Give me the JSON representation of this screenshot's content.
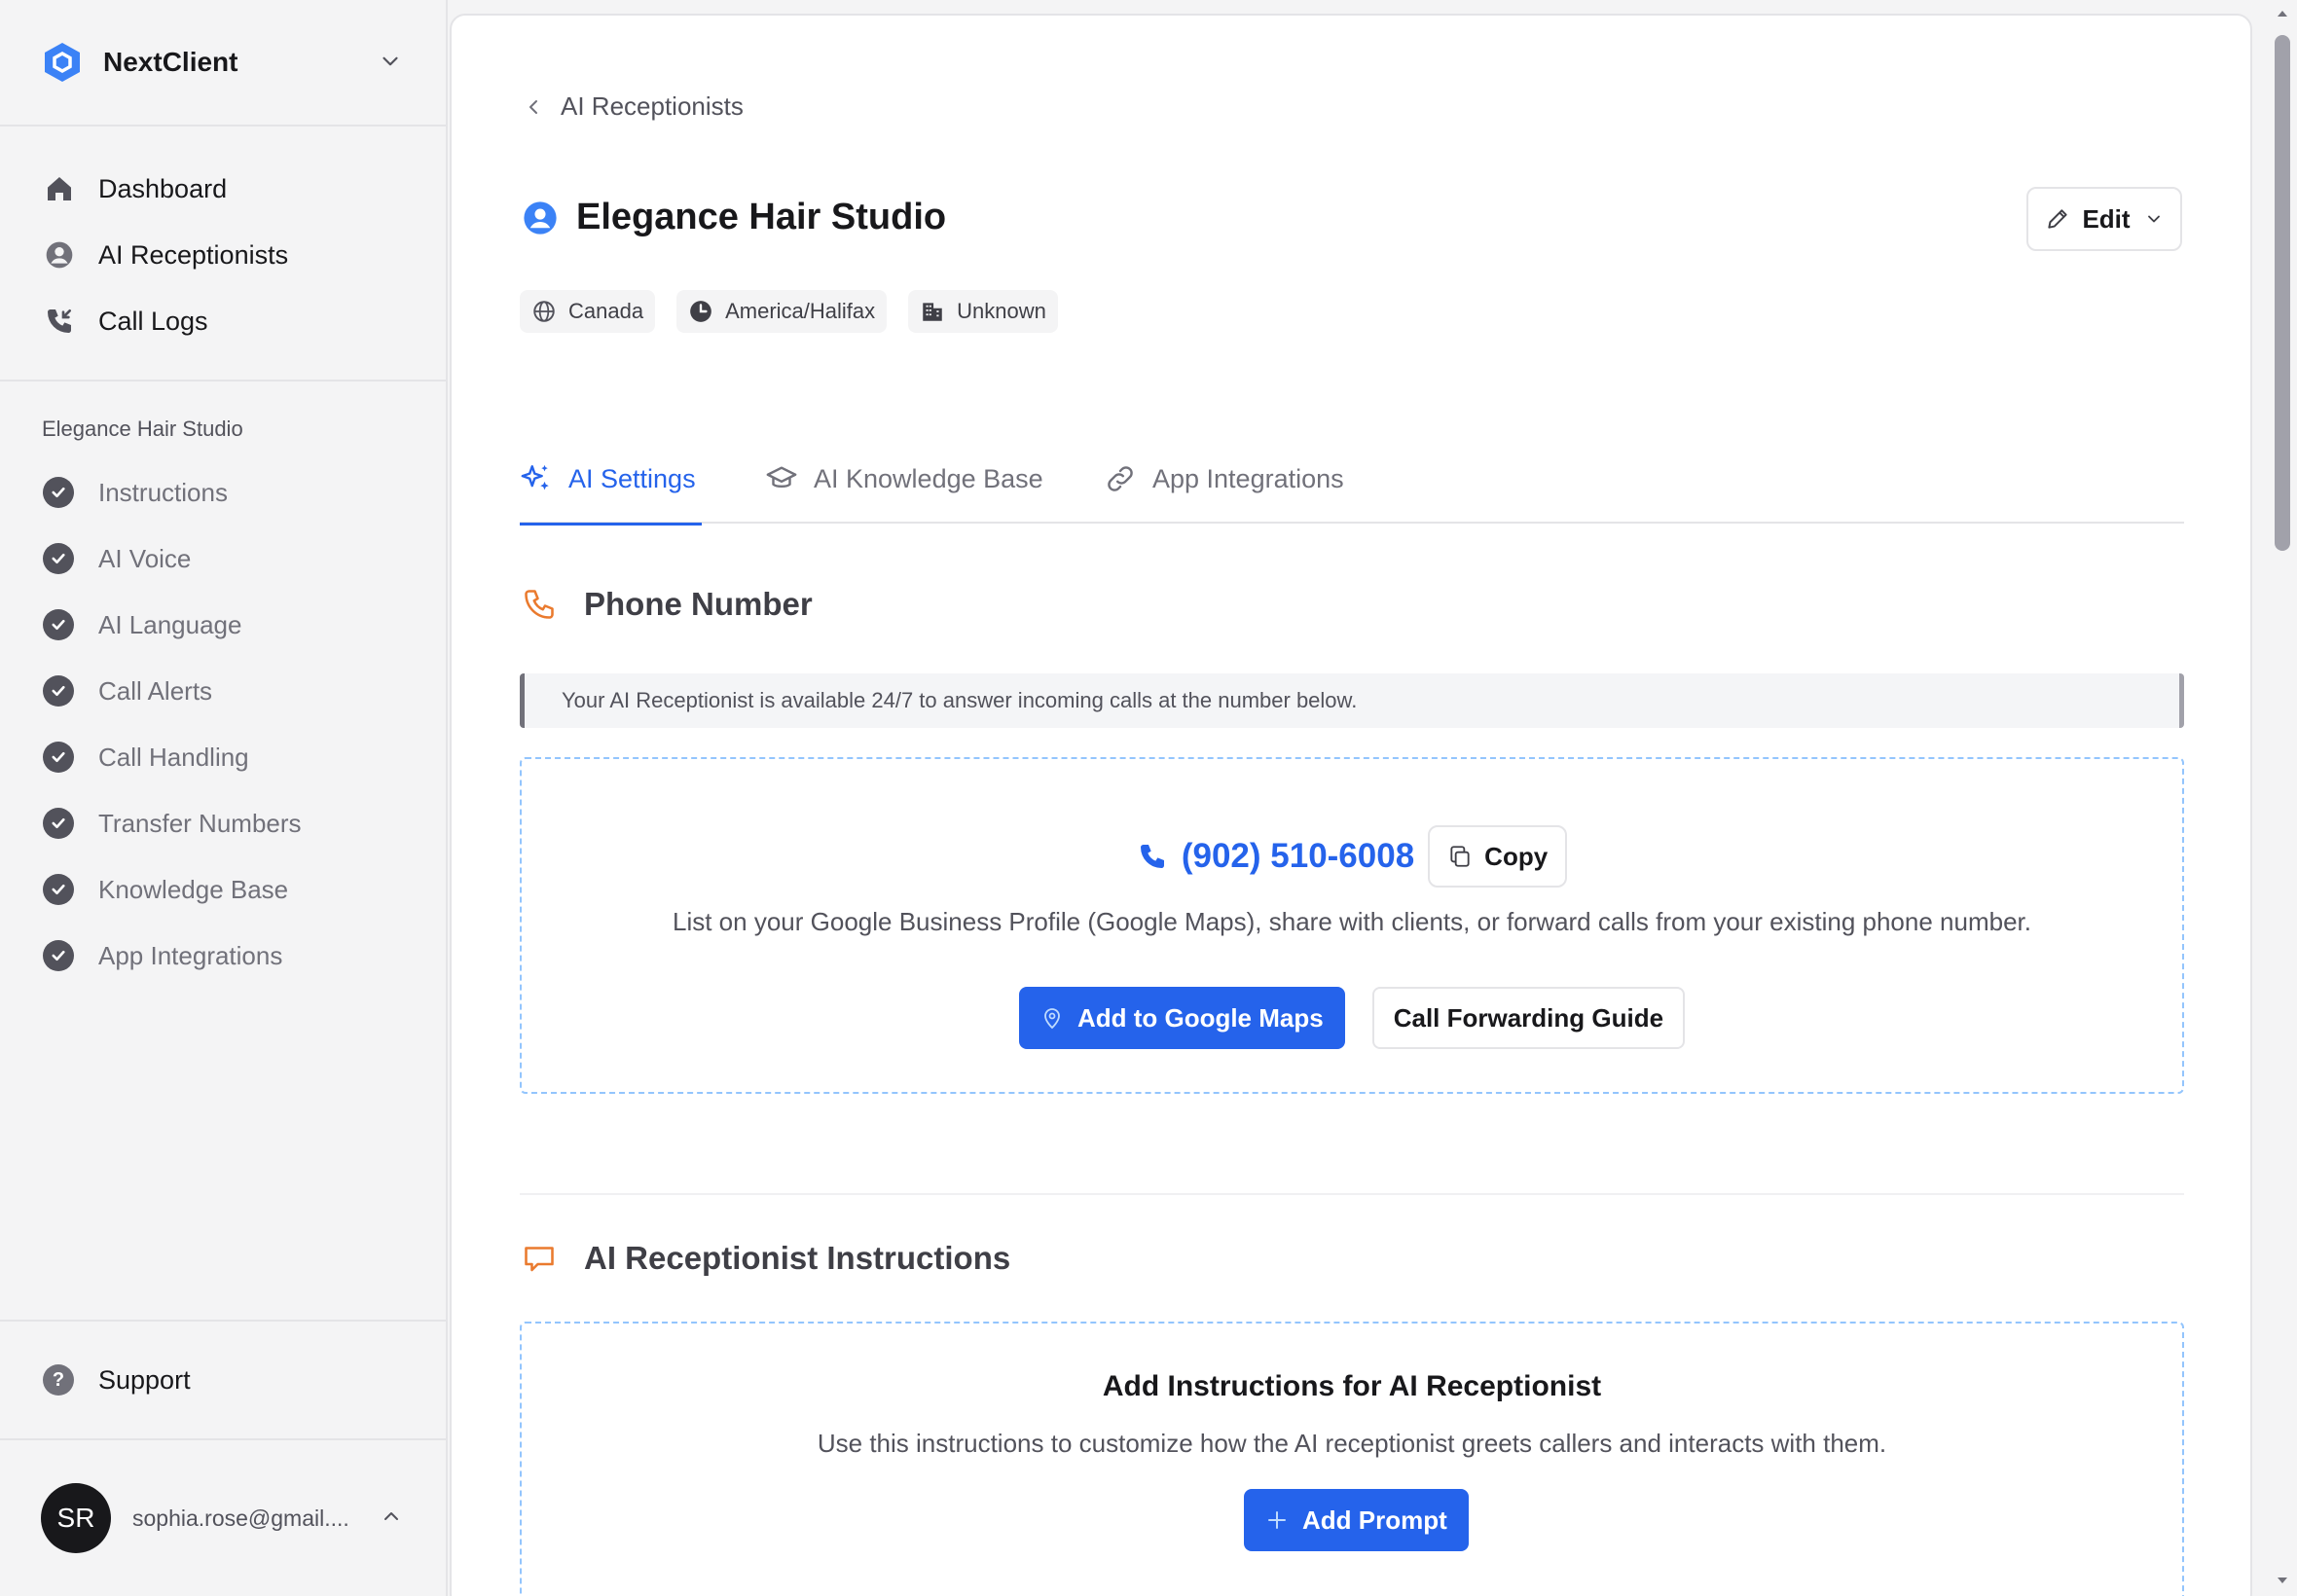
{
  "brand": {
    "name": "NextClient",
    "logo_icon": "hexagon-logo-icon",
    "accent": "#2563eb"
  },
  "nav": {
    "main": [
      {
        "label": "Dashboard",
        "icon": "home-icon"
      },
      {
        "label": "AI Receptionists",
        "icon": "user-circle-icon"
      },
      {
        "label": "Call Logs",
        "icon": "phone-incoming-icon"
      }
    ],
    "section_title": "Elegance Hair Studio",
    "sub": [
      {
        "label": "Instructions"
      },
      {
        "label": "AI Voice"
      },
      {
        "label": "AI Language"
      },
      {
        "label": "Call Alerts"
      },
      {
        "label": "Call Handling"
      },
      {
        "label": "Transfer Numbers"
      },
      {
        "label": "Knowledge Base"
      },
      {
        "label": "App Integrations"
      }
    ],
    "support": "Support"
  },
  "user": {
    "initials": "SR",
    "email": "sophia.rose@gmail...."
  },
  "page": {
    "breadcrumb": "AI Receptionists",
    "title": "Elegance Hair Studio",
    "edit_label": "Edit",
    "chips": [
      {
        "label": "Canada",
        "icon": "globe-icon"
      },
      {
        "label": "America/Halifax",
        "icon": "clock-icon"
      },
      {
        "label": "Unknown",
        "icon": "building-icon"
      }
    ],
    "tabs": [
      {
        "label": "AI Settings",
        "icon": "sparkles-icon",
        "active": true
      },
      {
        "label": "AI Knowledge Base",
        "icon": "graduation-cap-icon",
        "active": false
      },
      {
        "label": "App Integrations",
        "icon": "link-icon",
        "active": false
      }
    ]
  },
  "phone_section": {
    "title": "Phone Number",
    "info": "Your AI Receptionist is available 24/7 to answer incoming calls at the number below.",
    "number": "(902) 510-6008",
    "copy_label": "Copy",
    "description": "List on your Google Business Profile (Google Maps), share with clients, or forward calls from your existing phone number.",
    "maps_button": "Add to Google Maps",
    "guide_button": "Call Forwarding Guide"
  },
  "instructions_section": {
    "title": "AI Receptionist Instructions",
    "card_title": "Add Instructions for AI Receptionist",
    "card_desc": "Use this instructions to customize how the AI receptionist greets callers and interacts with them.",
    "button": "Add Prompt"
  }
}
